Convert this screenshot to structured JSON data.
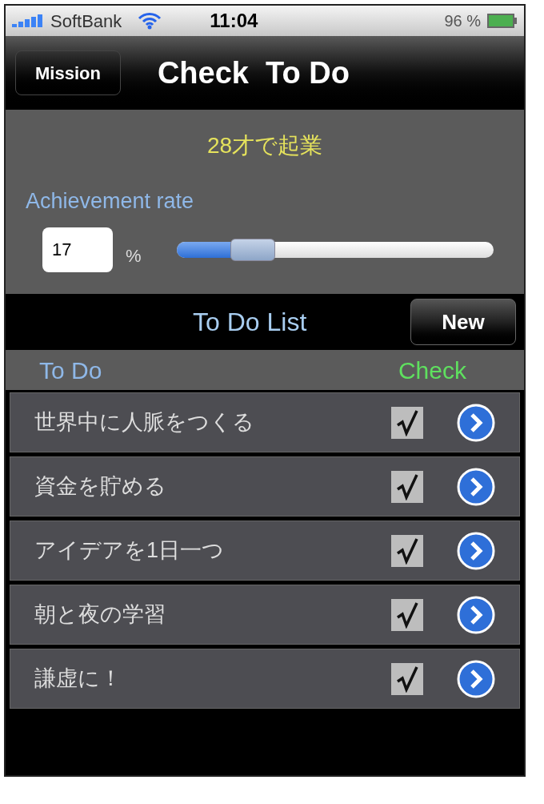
{
  "status_bar": {
    "carrier": "SoftBank",
    "time": "11:04",
    "battery": "96 %"
  },
  "nav_bar": {
    "back_button": "Mission",
    "title": "Check  To Do"
  },
  "goal": "28才で起業",
  "achievement": {
    "label": "Achievement rate",
    "value": "17",
    "unit": "%",
    "level": 0.17
  },
  "list_bar": {
    "title": "To Do List",
    "new_button": "New"
  },
  "columns": [
    "To Do",
    "Check"
  ],
  "todos": [
    {
      "text": "世界中に人脈をつくる",
      "checked": true
    },
    {
      "text": "資金を貯める",
      "checked": true
    },
    {
      "text": "アイデアを1日一つ",
      "checked": true
    },
    {
      "text": "朝と夜の学習",
      "checked": true
    },
    {
      "text": "謙虚に！",
      "checked": true
    }
  ]
}
